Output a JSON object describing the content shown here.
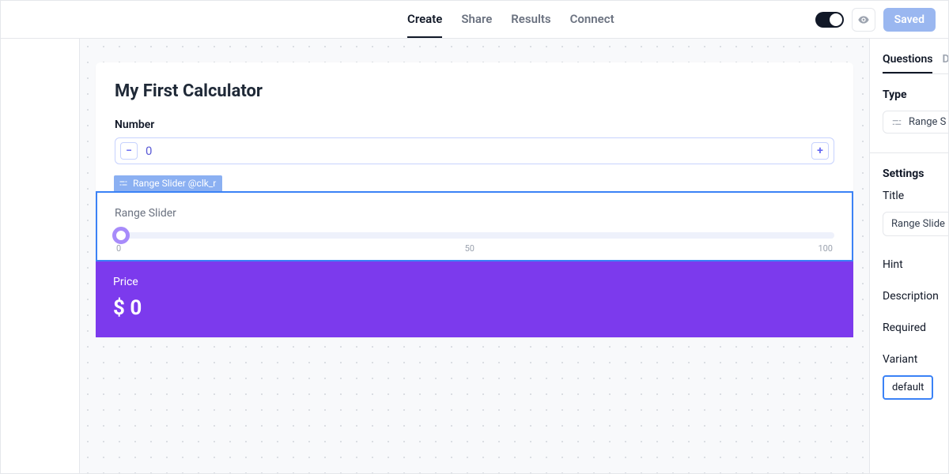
{
  "topnav": {
    "tabs": [
      "Create",
      "Share",
      "Results",
      "Connect"
    ],
    "active": 0,
    "saved_label": "Saved"
  },
  "calculator": {
    "title": "My First Calculator",
    "number_field": {
      "label": "Number",
      "value": "0"
    },
    "range_elem": {
      "tag": "Range Slider @clk_r",
      "title": "Range Slider",
      "tick_min": "0",
      "tick_mid": "50",
      "tick_max": "100"
    },
    "price": {
      "label": "Price",
      "value": "$ 0"
    }
  },
  "right": {
    "tabs": [
      "Questions",
      "D"
    ],
    "type_label": "Type",
    "type_value": "Range S",
    "settings_label": "Settings",
    "props": {
      "title_label": "Title",
      "title_value": "Range Slide",
      "hint": "Hint",
      "description": "Description",
      "required": "Required",
      "variant_label": "Variant",
      "variant_value": "default"
    }
  }
}
